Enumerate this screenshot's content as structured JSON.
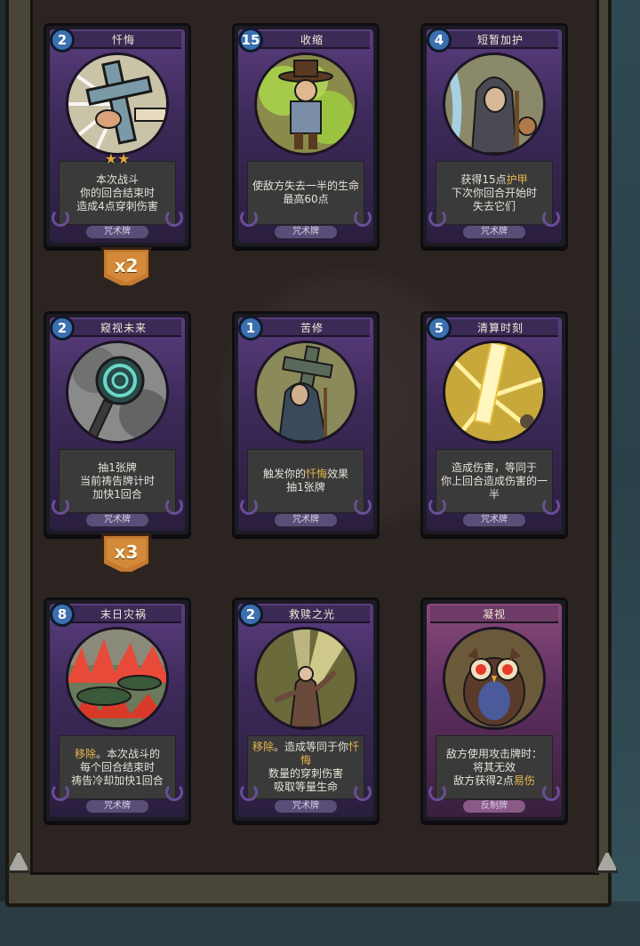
{
  "cards": [
    {
      "id": "penance",
      "cost": "2",
      "title": "忏悔",
      "desc": [
        "本次战斗",
        "你的回合结束时",
        "造成4点穿刺伤害"
      ],
      "type": "咒术牌",
      "stars": "★★",
      "multiplier": "x2",
      "art_icon": "cross-icon"
    },
    {
      "id": "shrink",
      "cost": "15",
      "title": "收缩",
      "desc": [
        "使敌方失去一半的生命",
        "最高60点"
      ],
      "type": "咒术牌",
      "art_icon": "shrinking-man-icon"
    },
    {
      "id": "temp-protect",
      "cost": "4",
      "title": "短暂加护",
      "desc_html": "获得15点<span class=\"hl\">护甲</span><br>下次你回合开始时<br>失去它们",
      "desc": [
        "获得15点",
        "护甲",
        "下次你回合开始时",
        "失去它们"
      ],
      "type": "咒术牌",
      "art_icon": "hooded-figure-icon"
    },
    {
      "id": "foresee",
      "cost": "2",
      "title": "窥视未来",
      "desc": [
        "抽1张牌",
        "当前祷告牌计时",
        "加快1回合"
      ],
      "type": "咒术牌",
      "multiplier": "x3",
      "art_icon": "swirl-scepter-icon"
    },
    {
      "id": "ascetic",
      "cost": "1",
      "title": "苦修",
      "desc": [
        "触发你的",
        "忏悔",
        "效果",
        "抽1张牌"
      ],
      "type": "咒术牌",
      "art_icon": "monk-icon"
    },
    {
      "id": "reckoning",
      "cost": "5",
      "title": "清算时刻",
      "desc": [
        "造成伤害，等同于",
        "你上回合造成伤害的一半"
      ],
      "type": "咒术牌",
      "art_icon": "light-sword-icon"
    },
    {
      "id": "doomsday",
      "cost": "8",
      "title": "末日灾祸",
      "desc": [
        "移除",
        "。本次战斗的",
        "每个回合结束时",
        "祷告冷却加快1回合"
      ],
      "type": "咒术牌",
      "art_icon": "burning-land-icon"
    },
    {
      "id": "redemption-light",
      "cost": "2",
      "title": "救赎之光",
      "desc": [
        "移除",
        "。造成等同于你",
        "忏悔",
        "数量的穿刺伤害",
        "吸取等量生命"
      ],
      "type": "咒术牌",
      "art_icon": "light-rays-icon"
    },
    {
      "id": "gaze",
      "cost": "",
      "title": "凝视",
      "desc": [
        "敌方使用攻击牌时：",
        "将其无效",
        "敌方获得2点",
        "易伤"
      ],
      "type": "反制牌",
      "art_icon": "owl-icon"
    }
  ],
  "colors": {
    "mana": "#3b6fb0",
    "highlight": "#e6b84a",
    "spell_frame": "#5a3d7e",
    "reaction_frame": "#8a4a7a",
    "multiplier_badge": "#c47a30"
  }
}
